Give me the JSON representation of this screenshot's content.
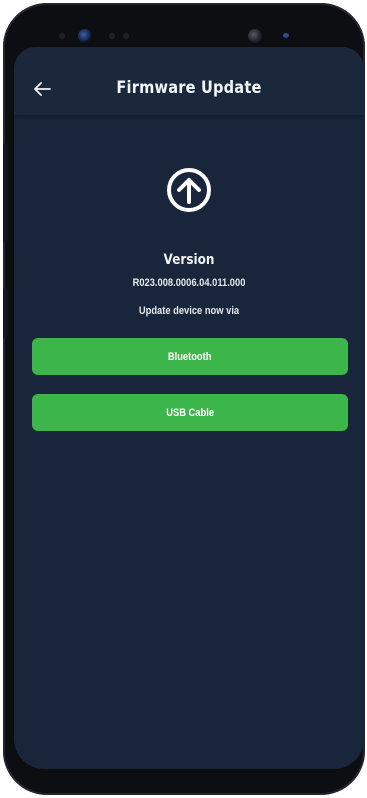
{
  "header": {
    "title": "Firmware Update",
    "back_icon": "arrow-left-icon"
  },
  "content": {
    "icon": "arrow-up-circle-icon",
    "version_label": "Version",
    "version_value": "R023.008.0006.04.011.000",
    "instruction": "Update device now via"
  },
  "actions": {
    "bluetooth_label": "Bluetooth",
    "usb_label": "USB Cable"
  },
  "colors": {
    "background": "#18253a",
    "header": "#1b283c",
    "button": "#3cb54a",
    "text": "#f2f4f7"
  }
}
